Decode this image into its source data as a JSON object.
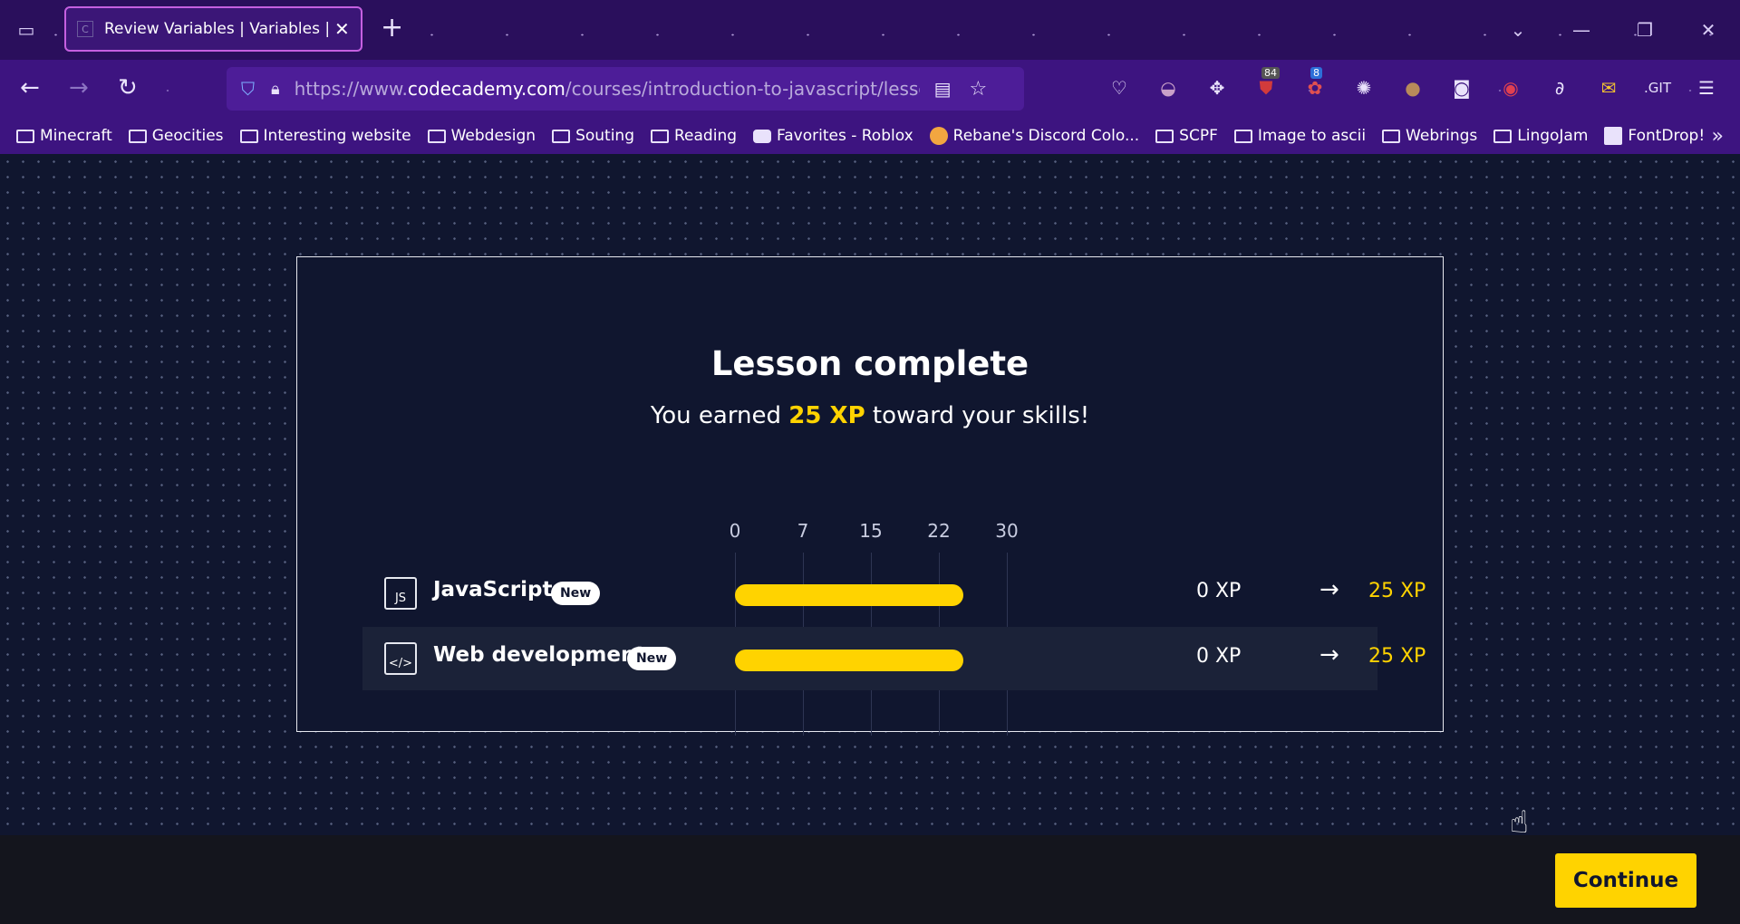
{
  "browser": {
    "tab_title": "Review Variables | Variables | Co",
    "tab_close": "✕",
    "new_tab": "+",
    "url_prefix": "https://www.",
    "url_domain": "codecademy.com",
    "url_path": "/courses/introduction-to-javascript/lessons/va",
    "extension_badges": {
      "ublock": "84",
      "second": "8"
    },
    "bookmarks": [
      "Minecraft",
      "Geocities",
      "Interesting website",
      "Webdesign",
      "Souting",
      "Reading",
      "Favorites - Roblox",
      "Rebane's Discord Colo...",
      "SCPF",
      "Image to ascii",
      "Webrings",
      "LingoJam",
      "FontDrop!"
    ]
  },
  "lesson": {
    "title": "Lesson complete",
    "subtitle_before": "You earned ",
    "subtitle_xp": "25 XP",
    "subtitle_after": " toward your skills!"
  },
  "chart_data": {
    "type": "bar",
    "title": "",
    "xlabel": "",
    "ylabel": "",
    "orientation": "horizontal",
    "scale_ticks": [
      "0",
      "7",
      "15",
      "22",
      "30"
    ],
    "xlim": [
      0,
      30
    ],
    "categories": [
      "JavaScript",
      "Web development"
    ],
    "values": [
      25,
      25
    ]
  },
  "skills": [
    {
      "icon_text": "JS",
      "name": "JavaScript",
      "badge": "New",
      "from": "0 XP",
      "arrow": "→",
      "to": "25 XP"
    },
    {
      "icon_text": "</>",
      "name": "Web development",
      "badge": "New",
      "from": "0 XP",
      "arrow": "→",
      "to": "25 XP"
    }
  ],
  "footer": {
    "continue_label": "Continue"
  },
  "colors": {
    "accent": "#ffd300",
    "page_bg": "#10162f",
    "browser_bg": "#3d1480"
  }
}
